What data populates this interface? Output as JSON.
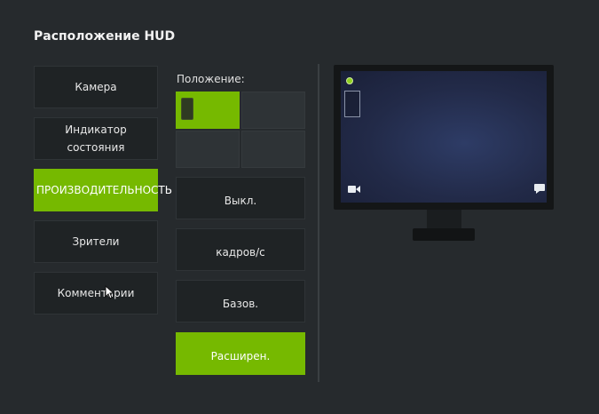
{
  "title": "Расположение HUD",
  "categories": [
    {
      "label": "Камера"
    },
    {
      "label": "Индикатор\nсостояния"
    },
    {
      "label": "ПРОИЗВОДИТЕЛЬНОСТЬ",
      "selected": true
    },
    {
      "label": "Зрители"
    },
    {
      "label": "Комментарии"
    }
  ],
  "position": {
    "label": "Положение:",
    "cells": [
      "top-left",
      "top-right",
      "bottom-left",
      "bottom-right"
    ],
    "selected": "top-left"
  },
  "levels": [
    {
      "label": "Выкл."
    },
    {
      "label": "кадров/с"
    },
    {
      "label": "Базов."
    },
    {
      "label": "Расширен.",
      "selected": true
    }
  ],
  "colors": {
    "accent": "#76b900",
    "background": "#262a2d",
    "button": "#1f2325"
  },
  "preview_icons": [
    "status-dot-icon",
    "camera-icon",
    "chat-icon"
  ]
}
